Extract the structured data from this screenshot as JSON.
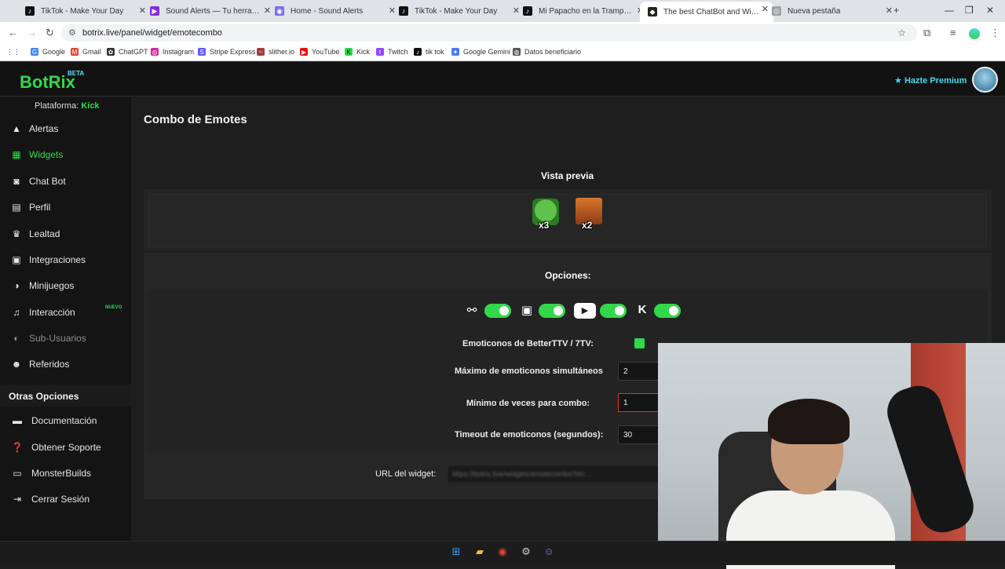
{
  "browser": {
    "tabs": [
      {
        "label": "TikTok - Make Your Day",
        "icon": "tiktok-icon"
      },
      {
        "label": "Sound Alerts — Tu herramienta",
        "icon": "soundalerts-icon"
      },
      {
        "label": "Home - Sound Alerts",
        "icon": "soundalerts-home-icon"
      },
      {
        "label": "TikTok - Make Your Day",
        "icon": "tiktok-icon"
      },
      {
        "label": "Mi Papacho en la Trampa: Un M",
        "icon": "tiktok-icon"
      },
      {
        "label": "The best ChatBot and Widgets",
        "icon": "botrix-icon"
      },
      {
        "label": "Nueva pestaña",
        "icon": "chrome-icon"
      }
    ],
    "url": "botrix.live/panel/widget/emotecombo",
    "bookmarks": [
      "Google",
      "Gmail",
      "ChatGPT",
      "Instagram",
      "Stripe Express",
      "slither.io",
      "YouTube",
      "Kick",
      "Twitch",
      "tik tok",
      "Google Gemini",
      "Datos beneficiario"
    ]
  },
  "header": {
    "logo": "BotRix",
    "beta": "BETA",
    "premium": "Hazte Premium"
  },
  "sidebar": {
    "platform_label": "Plataforma:",
    "platform_value": "Kick",
    "items": [
      {
        "label": "Alertas"
      },
      {
        "label": "Widgets"
      },
      {
        "label": "Chat Bot"
      },
      {
        "label": "Perfil"
      },
      {
        "label": "Lealtad"
      },
      {
        "label": "Integraciones"
      },
      {
        "label": "Minijuegos"
      },
      {
        "label": "Interacción"
      },
      {
        "label": "Sub-Usuarios"
      },
      {
        "label": "Referidos"
      }
    ],
    "nuevo_badge": "NUEVO",
    "other_title": "Otras Opciones",
    "other_items": [
      {
        "label": "Documentación"
      },
      {
        "label": "Obtener Soporte"
      },
      {
        "label": "MonsterBuilds"
      },
      {
        "label": "Cerrar Sesión"
      }
    ]
  },
  "main": {
    "title": "Combo de Emotes",
    "preview_title": "Vista previa",
    "emotes": [
      {
        "name": "peepo-emote",
        "count": "x3"
      },
      {
        "name": "face-emote",
        "count": "x2"
      }
    ],
    "options_title": "Opciones:",
    "platform_toggles": [
      {
        "icon": "7tv-icon",
        "on": true
      },
      {
        "icon": "twitch-icon",
        "on": true
      },
      {
        "icon": "youtube-icon",
        "on": true
      },
      {
        "icon": "kick-icon",
        "on": true
      }
    ],
    "bttv_label": "Emoticonos de BetterTTV / 7TV:",
    "max_label": "Máximo de emoticonos simultáneos",
    "max_value": "2",
    "min_label": "Mínimo de veces para combo:",
    "min_value": "1",
    "timeout_label": "Timeout de emoticonos (segundos):",
    "timeout_value": "30",
    "url_label": "URL del widget:",
    "url_value": "https://botrix.live/widgets/emotecombo?id=..."
  },
  "colors": {
    "accent": "#33d84a",
    "premium": "#4ad9e8",
    "background": "#1e1e1e"
  }
}
